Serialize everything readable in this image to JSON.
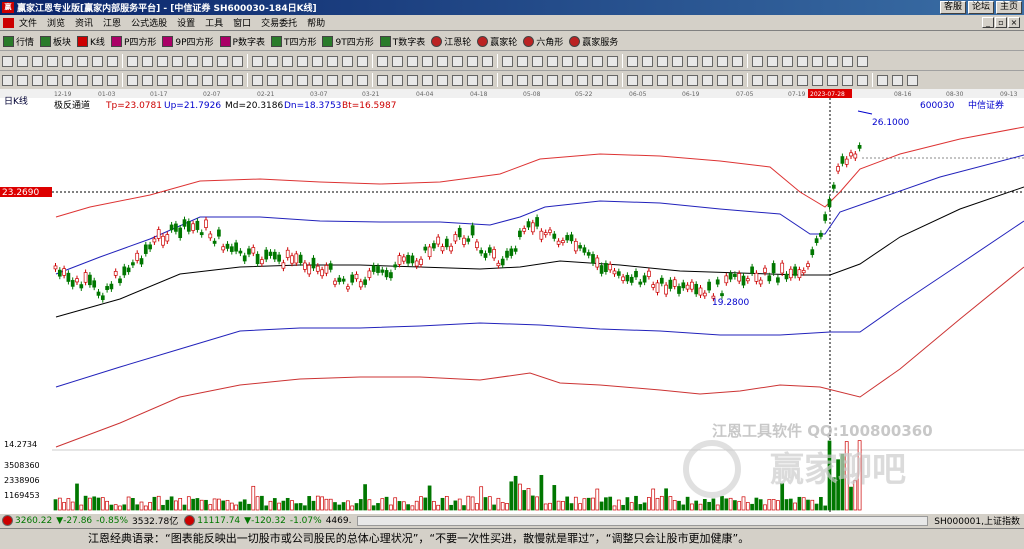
{
  "title_bar": {
    "title": "赢家江恩专业版[赢家内部服务平台] - [中信证券  SH600030-184日K线]",
    "links": [
      "客服",
      "论坛",
      "主页"
    ]
  },
  "menu": [
    "文件",
    "浏览",
    "资讯",
    "江恩",
    "公式选股",
    "设置",
    "工具",
    "窗口",
    "交易委托",
    "帮助"
  ],
  "toolbar1": [
    "行情",
    "板块",
    "K线",
    "P四方形",
    "9P四方形",
    "P数字表",
    "T四方形",
    "9T四方形",
    "T数字表",
    "江恩轮",
    "赢家轮",
    "六角形",
    "赢家服务"
  ],
  "chart_header": {
    "left_label": "日K线",
    "indicator": "极反通道",
    "tp": "Tp=23.0781",
    "up": "Up=21.7926",
    "md": "Md=20.3186",
    "dn": "Dn=18.3753",
    "bt": "Bt=16.5987",
    "right_code": "600030",
    "right_name": "中信证券"
  },
  "price_label": "23.2690",
  "high_label": "26.1000",
  "low_label": "19.2800",
  "dates": [
    "12-19",
    "01-03",
    "01-17",
    "02-07",
    "02-21",
    "03-07",
    "03-21",
    "04-04",
    "04-18",
    "05-08",
    "05-22",
    "06-05",
    "06-19",
    "07-05",
    "07-19",
    "2023-07-28",
    "08-16",
    "08-30",
    "09-13"
  ],
  "volume_axis": [
    "14.2734",
    "3508360",
    "2338906",
    "1169453"
  ],
  "watermark": {
    "line1": "江恩工具软件  QQ:100800360",
    "line2": "赢家聊吧"
  },
  "status": {
    "sh_val": "3260.22",
    "sh_chg": "▼-27.86",
    "sh_pct": "-0.85%",
    "sh_amt": "3532.78亿",
    "sz_val": "11117.74",
    "sz_chg": "▼-120.32",
    "sz_pct": "-1.07%",
    "sz_amt": "4469.",
    "right": "SH000001,上证指数"
  },
  "quote": "江恩经典语录：“图表能反映出一切股市或公司股民的总体心理状况”，“不要一次性买进，散慢就是罪过”，“调整只会让股市更加健康”。",
  "chart_data": {
    "type": "candlestick",
    "series": [
      {
        "name": "Tp",
        "last": 23.0781
      },
      {
        "name": "Up",
        "last": 21.7926
      },
      {
        "name": "Md",
        "last": 20.3186
      },
      {
        "name": "Dn",
        "last": 18.3753
      },
      {
        "name": "Bt",
        "last": 16.5987
      }
    ],
    "price_marks": {
      "current": 23.269,
      "high": 26.1,
      "low": 19.28
    },
    "ylim": [
      14.2734,
      26.5
    ],
    "vol_ticks": [
      1169453,
      2338906,
      3508360
    ]
  }
}
